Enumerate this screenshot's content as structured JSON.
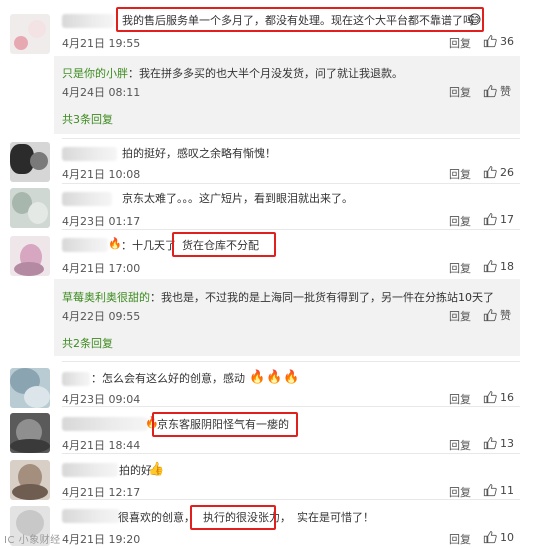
{
  "comments": [
    {
      "text": "我的售后服务单一个多月了，都没有处理。现在这个大平台都不靠谱了吗",
      "time": "4月21日 19:55",
      "reply": "回复",
      "likes": "36"
    },
    {
      "text": "拍的挺好，感叹之余略有惭愧！",
      "time": "4月21日 10:08",
      "reply": "回复",
      "likes": "26"
    },
    {
      "text": "京东太难了。。。这广短片，看到眼泪就出来了。",
      "time": "4月23日 01:17",
      "reply": "回复",
      "likes": "17"
    },
    {
      "text_prefix": "：十几天了",
      "text_boxed": "货在仓库不分配",
      "time": "4月21日 17:00",
      "reply": "回复",
      "likes": "18"
    },
    {
      "text": "：怎么会有这么好的创意，感动",
      "time": "4月23日 09:04",
      "reply": "回复",
      "likes": "16"
    },
    {
      "text_boxed": "京东客服阴阳怪气有一瘘的",
      "time": "4月21日 18:44",
      "reply": "回复",
      "likes": "13"
    },
    {
      "text": "拍的好",
      "time": "4月21日 12:17",
      "reply": "回复",
      "likes": "11"
    },
    {
      "text_prefix": "很喜欢的创意，",
      "text_boxed": "执行的很没张力，",
      "text_suffix": "实在是可惜了！",
      "time": "4月21日 19:20",
      "reply": "回复",
      "likes": "10"
    }
  ],
  "sub_replies": [
    {
      "name": "只是你的小胖",
      "text": "：我在拼多多买的也大半个月没发货，问了就让我退款。",
      "time": "4月24日 08:11",
      "reply": "回复",
      "likes": "赞"
    },
    {
      "name": "草莓奥利奥很甜的",
      "text": "：我也是，不过我的是上海同一批货有得到了，另一件在分拣站10天了",
      "time": "4月22日 09:55",
      "reply": "回复",
      "likes": "赞"
    }
  ],
  "more_links": [
    "共3条回复",
    "共2条回复"
  ],
  "watermark": "IC 小象财经",
  "colors": {
    "highlight": "#e0201d",
    "username": "#3d8b1f",
    "subbox": "#f2f2f2"
  },
  "icons": [
    "thumbs-up-icon",
    "fire-emoji-icon",
    "thumbs-up-emoji-icon",
    "laughing-emoji-icon"
  ]
}
